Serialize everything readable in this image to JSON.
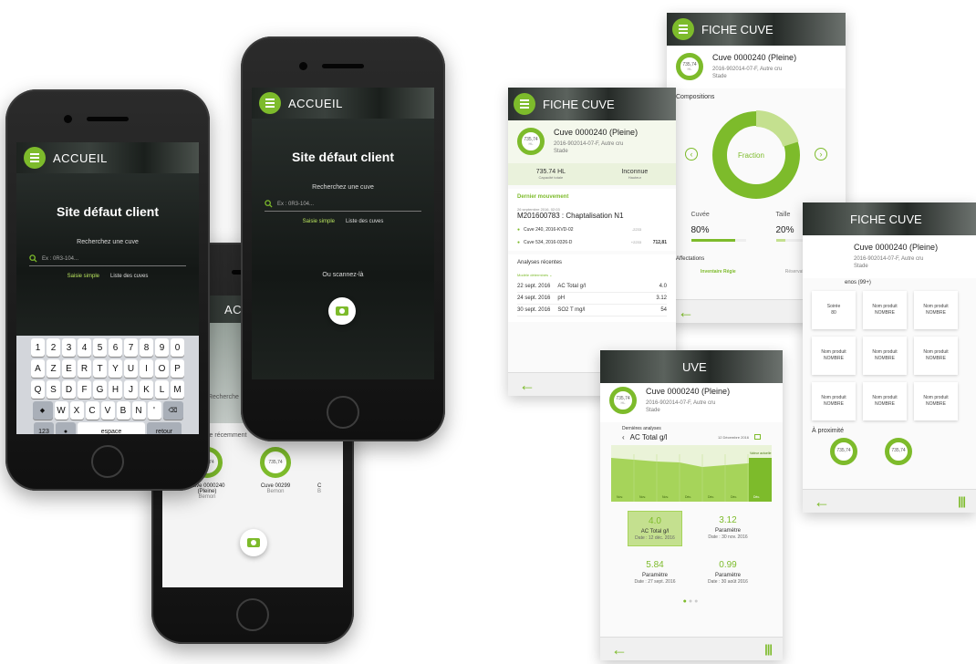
{
  "phone_search": {
    "header_title": "ACCUEIL",
    "hero_title": "Site défaut client",
    "search_prompt": "Recherchez une cuve",
    "search_placeholder": "Ex : 0R3-104...",
    "segment_active": "Saisie simple",
    "segment_inactive": "Liste des cuves",
    "keyboard": {
      "row1": [
        "1",
        "2",
        "3",
        "4",
        "5",
        "6",
        "7",
        "8",
        "9",
        "0"
      ],
      "row2": [
        "A",
        "Z",
        "E",
        "R",
        "T",
        "Y",
        "U",
        "I",
        "O",
        "P"
      ],
      "row3": [
        "Q",
        "S",
        "D",
        "F",
        "G",
        "H",
        "J",
        "K",
        "L",
        "M"
      ],
      "row4": [
        "W",
        "X",
        "C",
        "V",
        "B",
        "N",
        "'"
      ],
      "key_123": "123",
      "key_space": "espace",
      "key_return": "retour"
    }
  },
  "phone_scan": {
    "header_title": "ACCUEIL",
    "hero_title": "Site défaut client",
    "search_prompt": "Recherchez une cuve",
    "search_placeholder": "Ex : 0R3-104...",
    "segment_active": "Saisie simple",
    "segment_inactive": "Liste des cuves",
    "scan_prompt": "Ou scannez-là"
  },
  "phone_back": {
    "header_title": "ACCUEIL",
    "partial_text": "M",
    "partial_search": "Recherche",
    "recent_label": "le récemment",
    "recent": [
      {
        "gauge": "735,74",
        "name": "Cuve 0000240 (Pleine)",
        "sub": "Bemon"
      },
      {
        "gauge": "735,74",
        "name": "Cuve 00299",
        "sub": "Bemon"
      },
      {
        "gauge": "",
        "name": "C",
        "sub": "B"
      }
    ]
  },
  "card_fiche_main": {
    "header_title": "FICHE CUVE",
    "gauge_value": "735,74",
    "gauge_unit": "HL",
    "cuve_name": "Cuve 0000240 (Pleine)",
    "cuve_sub1": "2016-902014-07-F, Autre cru",
    "cuve_sub2": "Stade",
    "capacity_value": "735.74 HL",
    "capacity_label": "Capacité totale",
    "height_value": "Inconnue",
    "height_label": "Hauteur",
    "last_move_title": "Dernier mouvement",
    "last_move_date": "26 septembre 2016, 02:03",
    "last_move_name": "M201600783 : Chaptalisation N1",
    "moves": [
      {
        "label": "Cuve 240, 2016-KVD-02",
        "delta": "-2233",
        "value": ""
      },
      {
        "label": "Cuve 534, 2016-0326-D",
        "delta": "+2233",
        "value": "712,81"
      }
    ],
    "analyses_title": "Analyses récentes",
    "analyses_filter": "Modèle déterminés",
    "analyses": [
      {
        "date": "22 sept. 2016",
        "name": "AC Total g/l",
        "value": "4.0"
      },
      {
        "date": "24 sept. 2016",
        "name": "pH",
        "value": "3.12"
      },
      {
        "date": "30 sept. 2016",
        "name": "SO2 T mg/l",
        "value": "54"
      }
    ]
  },
  "card_compositions": {
    "header_title": "FICHE CUVE",
    "gauge_value": "735,74",
    "gauge_unit": "HL",
    "cuve_name": "Cuve 0000240 (Pleine)",
    "cuve_sub1": "2016-902014-07-F, Autre cru",
    "cuve_sub2": "Stade",
    "section_title": "Compositions",
    "donut_label": "Fraction",
    "cuvee_label": "Cuvée",
    "cuvee_value": "80%",
    "taille_label": "Taille",
    "taille_value": "20%",
    "affectations_title": "Affectations",
    "affectations_tab1": "Inventaire Régie",
    "affectations_tab2": "Réservations"
  },
  "card_products": {
    "header_title": "FICHE CUVE",
    "cuve_name": "Cuve 0000240 (Pleine)",
    "cuve_sub1": "2016-902014-07-F, Autre cru",
    "cuve_sub2": "Stade",
    "products_title": "enos (99+)",
    "products": [
      {
        "name": "Soirée",
        "value": "80"
      },
      {
        "name": "Nom produit",
        "value": "NOMBRE"
      },
      {
        "name": "Nom produit",
        "value": "NOMBRE"
      },
      {
        "name": "Nom produit",
        "value": "NOMBRE"
      },
      {
        "name": "Nom produit",
        "value": "NOMBRE"
      },
      {
        "name": "Nom produit",
        "value": "NOMBRE"
      },
      {
        "name": "Nom produit",
        "value": "NOMBRE"
      },
      {
        "name": "Nom produit",
        "value": "NOMBRE"
      },
      {
        "name": "Nom produit",
        "value": "NOMBRE"
      }
    ],
    "nearby_title": "À proximité",
    "nearby_gauges": [
      "735,74",
      "735,74"
    ]
  },
  "card_analyses": {
    "header_title": "UVE",
    "gauge_value": "735,74",
    "gauge_unit": "HL",
    "cuve_name": "Cuve 0000240 (Pleine)",
    "cuve_sub1": "2016-902014-07-F, Autre cru",
    "cuve_sub2": "Stade",
    "section_title": "Dernières analyses",
    "chart_title": "AC Total g/l",
    "chart_date": "12 Décembre 2016",
    "chart_x_labels": [
      "Nov.",
      "Nov.",
      "Nov.",
      "Déc.",
      "Déc.",
      "Déc.",
      "Déc."
    ],
    "chart_flag": "Valeur actuelle",
    "stats": [
      {
        "value": "4.0",
        "label": "AC Total g/l",
        "date": "Date : 12 déc. 2016",
        "highlight": true
      },
      {
        "value": "3.12",
        "label": "Paramètre",
        "date": "Date : 30 nov. 2016",
        "highlight": false
      },
      {
        "value": "5.84",
        "label": "Paramètre",
        "date": "Date : 27 sept. 2016",
        "highlight": false
      },
      {
        "value": "0.99",
        "label": "Paramètre",
        "date": "Date : 30 août 2016",
        "highlight": false
      }
    ]
  },
  "colors": {
    "accent": "#7dbb2b",
    "accent_light": "#c4e08f",
    "header_dark": "#2a302c"
  },
  "icons": {
    "menu": "hamburger-menu-icon",
    "search": "search-icon",
    "camera": "camera-icon",
    "back": "back-arrow-icon",
    "bars": "vertical-bars-icon",
    "pin": "location-pin-icon",
    "calendar": "calendar-icon",
    "prev": "chevron-left-icon",
    "next": "chevron-right-icon"
  }
}
